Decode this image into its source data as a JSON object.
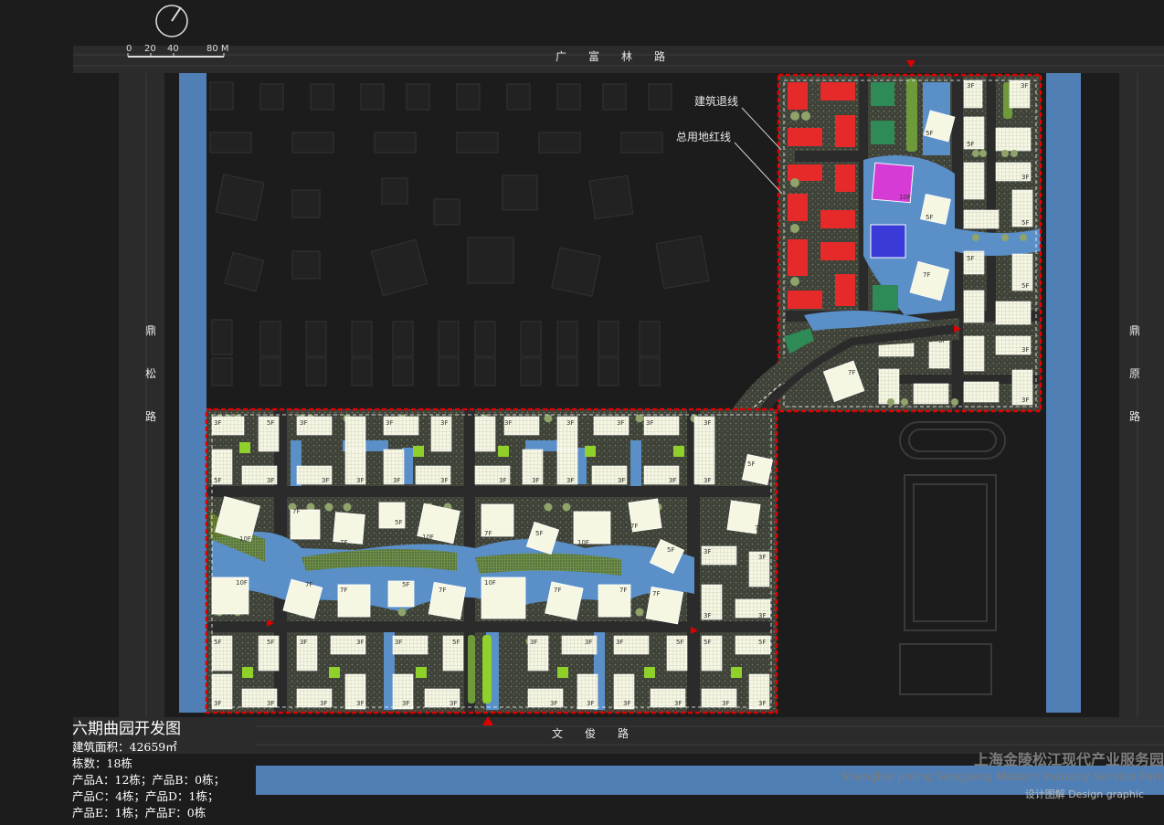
{
  "roads": {
    "north": "广　　富　　林　　路",
    "south": "文　　俊　　路",
    "west": [
      "鼎",
      "松",
      "路"
    ],
    "east": [
      "鼎",
      "原",
      "路"
    ]
  },
  "scale": {
    "ticks": [
      "0",
      "20",
      "40",
      "80 M"
    ]
  },
  "annotations": {
    "setback_line": "建筑退线",
    "red_line": "总用地红线"
  },
  "floor_labels": {
    "three": "3F",
    "five": "5F",
    "seven": "7F",
    "ten": "10F"
  },
  "legend": {
    "title": "六期曲园开发图",
    "area": "建筑面积：42659㎡",
    "count": "栋数：18栋",
    "product_ab": "产品A：12栋；产品B：0栋；",
    "product_cd": "产品C：4栋；产品D：1栋；",
    "product_ef": "产品E：1栋；产品F：0栋"
  },
  "brand": {
    "cn": "上海金陵松江现代产业服务园",
    "en": "Shanghai Jinling Songjiang Modern Industry Service Park",
    "caption": "设计图解  Design graphic"
  },
  "colors": {
    "background": "#1c1c1c",
    "road": "#2b2b2b",
    "water": "#4f7fb5",
    "red_line": "#e00000",
    "product_a": "#f6f7e3",
    "product_red": "#e62a2a",
    "product_green": "#2e8a56",
    "product_magenta": "#d63bd6",
    "product_blue": "#3a3ad8",
    "greenery": "#8fd12a"
  }
}
